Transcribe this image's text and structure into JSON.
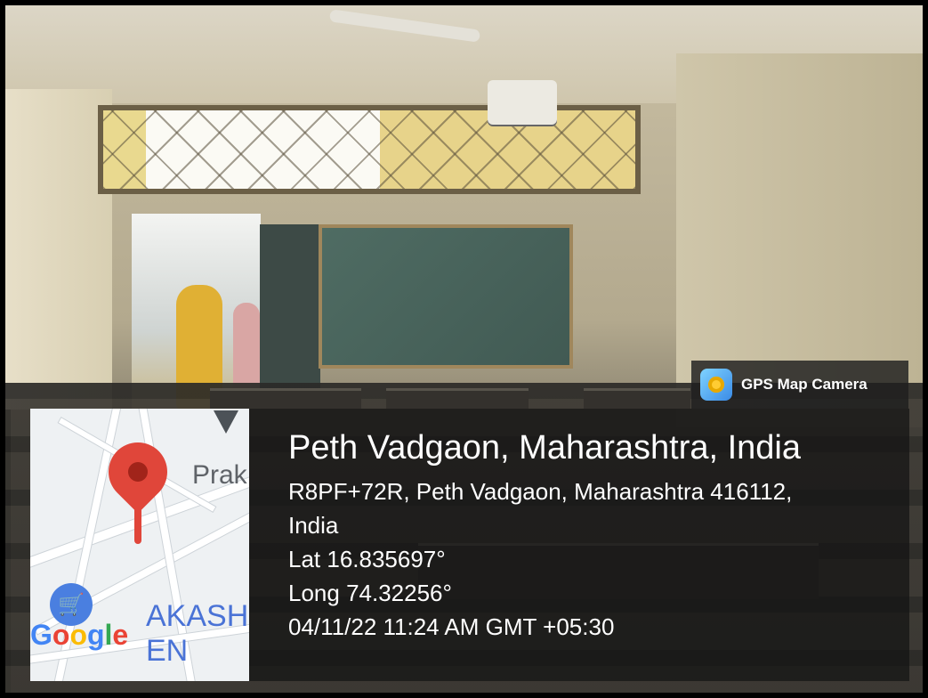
{
  "watermark": {
    "app_name": "GPS Map Camera",
    "icon": "gps-map-camera-app-icon"
  },
  "location": {
    "title": "Peth Vadgaon, Maharashtra, India",
    "address_line1": "R8PF+72R, Peth Vadgaon, Maharashtra 416112,",
    "address_line2": "India",
    "lat": "Lat 16.835697°",
    "long": "Long 74.32256°",
    "datetime": "04/11/22 11:24 AM GMT +05:30"
  },
  "map": {
    "label_prak": "Prak",
    "label_akash": "AKASH EN",
    "google_letters": [
      "G",
      "o",
      "o",
      "g",
      "l",
      "e"
    ],
    "pin_color": "#e0463a",
    "pin_icon": "map-pin-icon",
    "nav_icon": "navigation-arrow-icon",
    "shop_icon": "shopping-cart-icon"
  },
  "colors": {
    "overlay": "#141414",
    "blackboard": "#4a645c",
    "wall": "#d8cfb2"
  }
}
